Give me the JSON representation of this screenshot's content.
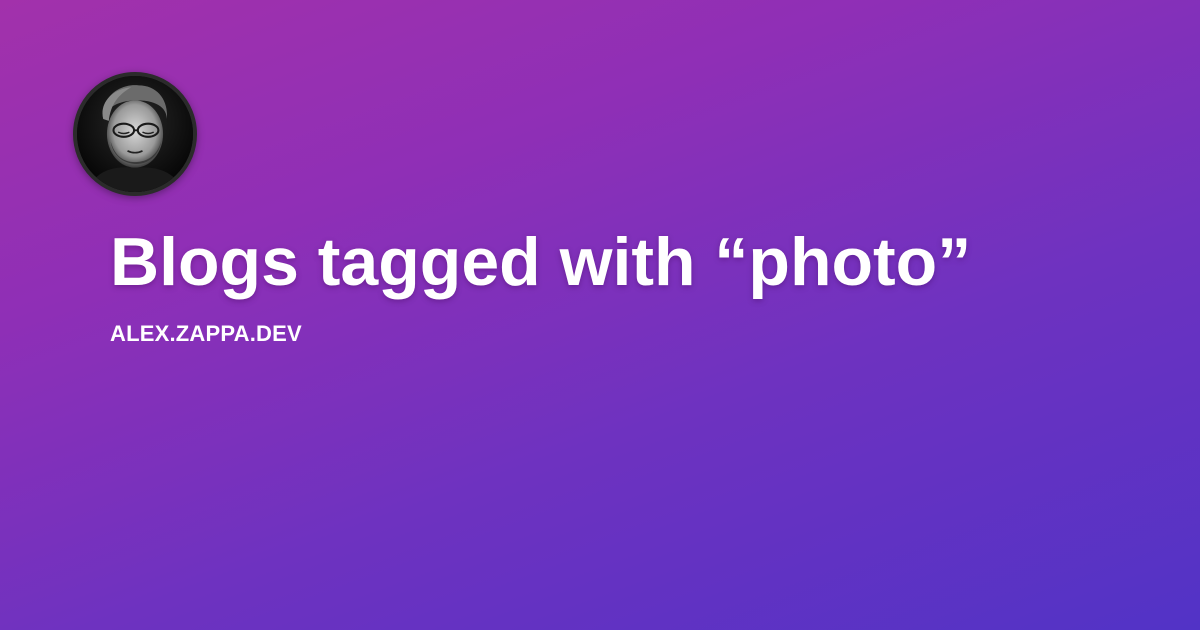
{
  "card": {
    "title": "Blogs tagged with “photo”",
    "site": "ALEX.ZAPPA.DEV"
  },
  "avatar": {
    "icon": "author-portrait",
    "style": "black-and-white photo"
  },
  "colors": {
    "gradient_start": "#a231ab",
    "gradient_end": "#5233c6",
    "text": "#ffffff",
    "avatar_border": "#2b2b2b"
  }
}
